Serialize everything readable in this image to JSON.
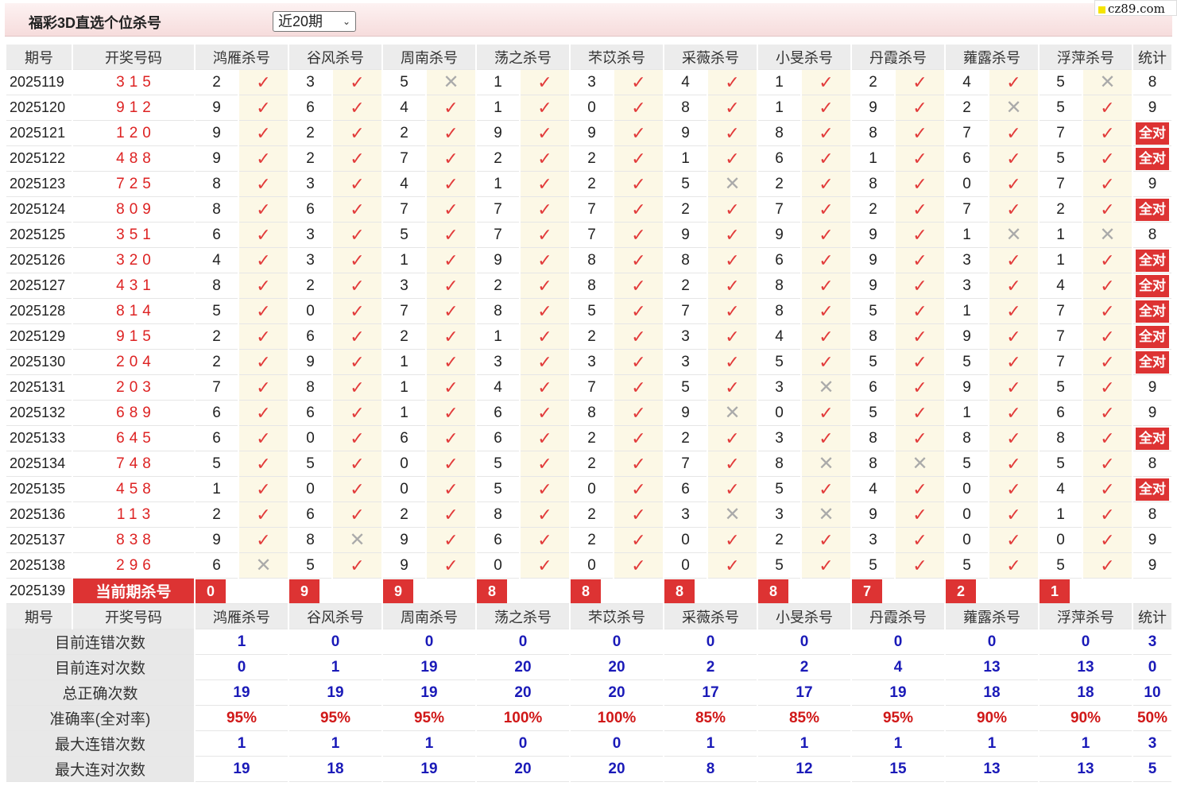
{
  "header": {
    "title": "福彩3D直选个位杀号",
    "select_value": "近20期",
    "logo_text": "cz89.com"
  },
  "columns": {
    "period": "期号",
    "draw": "开奖号码",
    "experts": [
      "鸿雁杀号",
      "谷风杀号",
      "周南杀号",
      "荡之杀号",
      "芣苡杀号",
      "采薇杀号",
      "小旻杀号",
      "丹霞杀号",
      "蕹露杀号",
      "浮萍杀号"
    ],
    "stat": "统计"
  },
  "rows": [
    {
      "period": "2025119",
      "draw": "315",
      "kills": [
        "2",
        "3",
        "5",
        "1",
        "3",
        "4",
        "1",
        "2",
        "4",
        "5"
      ],
      "hits": [
        1,
        1,
        0,
        1,
        1,
        1,
        1,
        1,
        1,
        0
      ],
      "stat": "8"
    },
    {
      "period": "2025120",
      "draw": "912",
      "kills": [
        "9",
        "6",
        "4",
        "1",
        "0",
        "8",
        "1",
        "9",
        "2",
        "5"
      ],
      "hits": [
        1,
        1,
        1,
        1,
        1,
        1,
        1,
        1,
        0,
        1
      ],
      "stat": "9"
    },
    {
      "period": "2025121",
      "draw": "120",
      "kills": [
        "9",
        "2",
        "2",
        "9",
        "9",
        "9",
        "8",
        "8",
        "7",
        "7"
      ],
      "hits": [
        1,
        1,
        1,
        1,
        1,
        1,
        1,
        1,
        1,
        1
      ],
      "stat": "全对"
    },
    {
      "period": "2025122",
      "draw": "488",
      "kills": [
        "9",
        "2",
        "7",
        "2",
        "2",
        "1",
        "6",
        "1",
        "6",
        "5"
      ],
      "hits": [
        1,
        1,
        1,
        1,
        1,
        1,
        1,
        1,
        1,
        1
      ],
      "stat": "全对"
    },
    {
      "period": "2025123",
      "draw": "725",
      "kills": [
        "8",
        "3",
        "4",
        "1",
        "2",
        "5",
        "2",
        "8",
        "0",
        "7"
      ],
      "hits": [
        1,
        1,
        1,
        1,
        1,
        0,
        1,
        1,
        1,
        1
      ],
      "stat": "9"
    },
    {
      "period": "2025124",
      "draw": "809",
      "kills": [
        "8",
        "6",
        "7",
        "7",
        "7",
        "2",
        "7",
        "2",
        "7",
        "2"
      ],
      "hits": [
        1,
        1,
        1,
        1,
        1,
        1,
        1,
        1,
        1,
        1
      ],
      "stat": "全对"
    },
    {
      "period": "2025125",
      "draw": "351",
      "kills": [
        "6",
        "3",
        "5",
        "7",
        "7",
        "9",
        "9",
        "9",
        "1",
        "1"
      ],
      "hits": [
        1,
        1,
        1,
        1,
        1,
        1,
        1,
        1,
        0,
        0
      ],
      "stat": "8"
    },
    {
      "period": "2025126",
      "draw": "320",
      "kills": [
        "4",
        "3",
        "1",
        "9",
        "8",
        "8",
        "6",
        "9",
        "3",
        "1"
      ],
      "hits": [
        1,
        1,
        1,
        1,
        1,
        1,
        1,
        1,
        1,
        1
      ],
      "stat": "全对"
    },
    {
      "period": "2025127",
      "draw": "431",
      "kills": [
        "8",
        "2",
        "3",
        "2",
        "8",
        "2",
        "8",
        "9",
        "3",
        "4"
      ],
      "hits": [
        1,
        1,
        1,
        1,
        1,
        1,
        1,
        1,
        1,
        1
      ],
      "stat": "全对"
    },
    {
      "period": "2025128",
      "draw": "814",
      "kills": [
        "5",
        "0",
        "7",
        "8",
        "5",
        "7",
        "8",
        "5",
        "1",
        "7"
      ],
      "hits": [
        1,
        1,
        1,
        1,
        1,
        1,
        1,
        1,
        1,
        1
      ],
      "stat": "全对"
    },
    {
      "period": "2025129",
      "draw": "915",
      "kills": [
        "2",
        "6",
        "2",
        "1",
        "2",
        "3",
        "4",
        "8",
        "9",
        "7"
      ],
      "hits": [
        1,
        1,
        1,
        1,
        1,
        1,
        1,
        1,
        1,
        1
      ],
      "stat": "全对"
    },
    {
      "period": "2025130",
      "draw": "204",
      "kills": [
        "2",
        "9",
        "1",
        "3",
        "3",
        "3",
        "5",
        "5",
        "5",
        "7"
      ],
      "hits": [
        1,
        1,
        1,
        1,
        1,
        1,
        1,
        1,
        1,
        1
      ],
      "stat": "全对"
    },
    {
      "period": "2025131",
      "draw": "203",
      "kills": [
        "7",
        "8",
        "1",
        "4",
        "7",
        "5",
        "3",
        "6",
        "9",
        "5"
      ],
      "hits": [
        1,
        1,
        1,
        1,
        1,
        1,
        0,
        1,
        1,
        1
      ],
      "stat": "9"
    },
    {
      "period": "2025132",
      "draw": "689",
      "kills": [
        "6",
        "6",
        "1",
        "6",
        "8",
        "9",
        "0",
        "5",
        "1",
        "6"
      ],
      "hits": [
        1,
        1,
        1,
        1,
        1,
        0,
        1,
        1,
        1,
        1
      ],
      "stat": "9"
    },
    {
      "period": "2025133",
      "draw": "645",
      "kills": [
        "6",
        "0",
        "6",
        "6",
        "2",
        "2",
        "3",
        "8",
        "8",
        "8"
      ],
      "hits": [
        1,
        1,
        1,
        1,
        1,
        1,
        1,
        1,
        1,
        1
      ],
      "stat": "全对"
    },
    {
      "period": "2025134",
      "draw": "748",
      "kills": [
        "5",
        "5",
        "0",
        "5",
        "2",
        "7",
        "8",
        "8",
        "5",
        "5"
      ],
      "hits": [
        1,
        1,
        1,
        1,
        1,
        1,
        0,
        0,
        1,
        1
      ],
      "stat": "8"
    },
    {
      "period": "2025135",
      "draw": "458",
      "kills": [
        "1",
        "0",
        "0",
        "5",
        "0",
        "6",
        "5",
        "4",
        "0",
        "4"
      ],
      "hits": [
        1,
        1,
        1,
        1,
        1,
        1,
        1,
        1,
        1,
        1
      ],
      "stat": "全对"
    },
    {
      "period": "2025136",
      "draw": "113",
      "kills": [
        "2",
        "6",
        "2",
        "8",
        "2",
        "3",
        "3",
        "9",
        "0",
        "1"
      ],
      "hits": [
        1,
        1,
        1,
        1,
        1,
        0,
        0,
        1,
        1,
        1
      ],
      "stat": "8"
    },
    {
      "period": "2025137",
      "draw": "838",
      "kills": [
        "9",
        "8",
        "9",
        "6",
        "2",
        "0",
        "2",
        "3",
        "0",
        "0"
      ],
      "hits": [
        1,
        0,
        1,
        1,
        1,
        1,
        1,
        1,
        1,
        1
      ],
      "stat": "9"
    },
    {
      "period": "2025138",
      "draw": "296",
      "kills": [
        "6",
        "5",
        "9",
        "0",
        "0",
        "0",
        "5",
        "5",
        "5",
        "5"
      ],
      "hits": [
        0,
        1,
        1,
        1,
        1,
        1,
        1,
        1,
        1,
        1
      ],
      "stat": "9"
    }
  ],
  "current": {
    "period": "2025139",
    "label": "当前期杀号",
    "kills": [
      "0",
      "9",
      "9",
      "8",
      "8",
      "8",
      "8",
      "7",
      "2",
      "1"
    ]
  },
  "stats": [
    {
      "label": "目前连错次数",
      "values": [
        "1",
        "0",
        "0",
        "0",
        "0",
        "0",
        "0",
        "0",
        "0",
        "0"
      ],
      "total": "3",
      "style": "blue"
    },
    {
      "label": "目前连对次数",
      "values": [
        "0",
        "1",
        "19",
        "20",
        "20",
        "2",
        "2",
        "4",
        "13",
        "13"
      ],
      "total": "0",
      "style": "blue"
    },
    {
      "label": "总正确次数",
      "values": [
        "19",
        "19",
        "19",
        "20",
        "20",
        "17",
        "17",
        "19",
        "18",
        "18"
      ],
      "total": "10",
      "style": "blue"
    },
    {
      "label": "准确率(全对率)",
      "values": [
        "95%",
        "95%",
        "95%",
        "100%",
        "100%",
        "85%",
        "85%",
        "95%",
        "90%",
        "90%"
      ],
      "total": "50%",
      "style": "red"
    },
    {
      "label": "最大连错次数",
      "values": [
        "1",
        "1",
        "1",
        "0",
        "0",
        "1",
        "1",
        "1",
        "1",
        "1"
      ],
      "total": "3",
      "style": "blue"
    },
    {
      "label": "最大连对次数",
      "values": [
        "19",
        "18",
        "19",
        "20",
        "20",
        "8",
        "12",
        "15",
        "13",
        "13"
      ],
      "total": "5",
      "style": "blue"
    }
  ],
  "icons": {
    "hit": "check-icon",
    "miss": "cross-icon"
  },
  "colors": {
    "accent_red": "#d33333",
    "stat_blue": "#1a1ab8",
    "mark_bg": "#fcf8e6"
  }
}
